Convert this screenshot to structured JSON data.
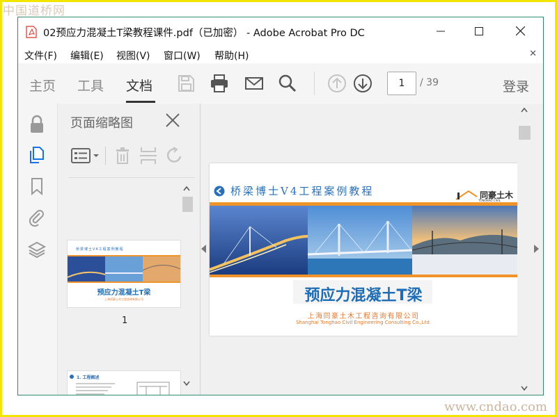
{
  "watermarks": {
    "top": "中国道桥网",
    "bottom": "www.cndao.com"
  },
  "window": {
    "title": "02预应力混凝土T梁教程课件.pdf（已加密） - Adobe Acrobat Pro DC"
  },
  "menubar": {
    "items": [
      "文件(F)",
      "编辑(E)",
      "视图(V)",
      "窗口(W)",
      "帮助(H)"
    ]
  },
  "toolbar": {
    "tabs": [
      "主页",
      "工具",
      "文档"
    ],
    "active_tab": "文档",
    "current_page": "1",
    "total_pages": "/ 39",
    "login": "登录"
  },
  "thumbnail_panel": {
    "title": "页面缩略图",
    "thumbnails": [
      {
        "page_label": "1",
        "header": "桥梁博士V4工程案例教程",
        "title": "预应力混凝土T梁",
        "subtitle": "上海同豪土木工程咨询有限公司"
      },
      {
        "header": "1. 工程概述"
      }
    ]
  },
  "document": {
    "header": "桥梁博士V4工程案例教程",
    "logo_text": "同豪土木",
    "logo_sub": "TONGHAO CIVIL ENGINEERING",
    "title": "预应力混凝土T梁",
    "company_cn": "上海同豪土木工程咨询有限公司",
    "company_en": "Shanghai Tonghao Civil Engineering Consulting Co.,Ltd."
  },
  "colors": {
    "accent_blue": "#1e6db4",
    "orange": "#f0932a",
    "window_border": "#2b8a68",
    "acrobat_red": "#d9342b"
  }
}
